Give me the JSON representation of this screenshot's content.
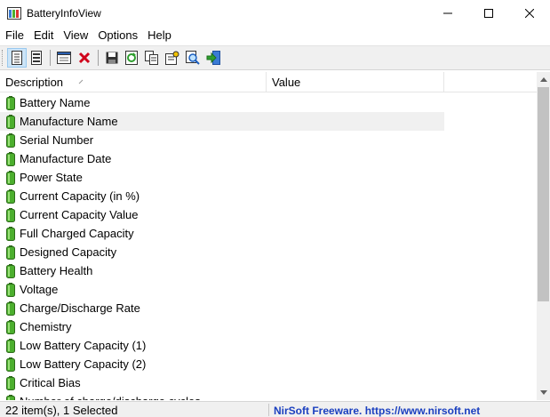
{
  "window": {
    "title": "BatteryInfoView"
  },
  "menu": [
    "File",
    "Edit",
    "View",
    "Options",
    "Help"
  ],
  "columns": {
    "description": "Description",
    "value": "Value"
  },
  "rows": [
    "Battery Name",
    "Manufacture Name",
    "Serial Number",
    "Manufacture Date",
    "Power State",
    "Current Capacity (in %)",
    "Current Capacity Value",
    "Full Charged Capacity",
    "Designed Capacity",
    "Battery Health",
    "Voltage",
    "Charge/Discharge Rate",
    "Chemistry",
    "Low Battery Capacity (1)",
    "Low Battery Capacity (2)",
    "Critical Bias",
    "Number of charge/discharge cycles"
  ],
  "selected_row": "Manufacture Name",
  "status": {
    "count": "22 item(s), 1 Selected",
    "credit": "NirSoft Freeware. https://www.nirsoft.net"
  },
  "colors": {
    "battery_green": "#4caf2e",
    "link_blue": "#1a3fbf",
    "selection": "#f0f0f0"
  }
}
